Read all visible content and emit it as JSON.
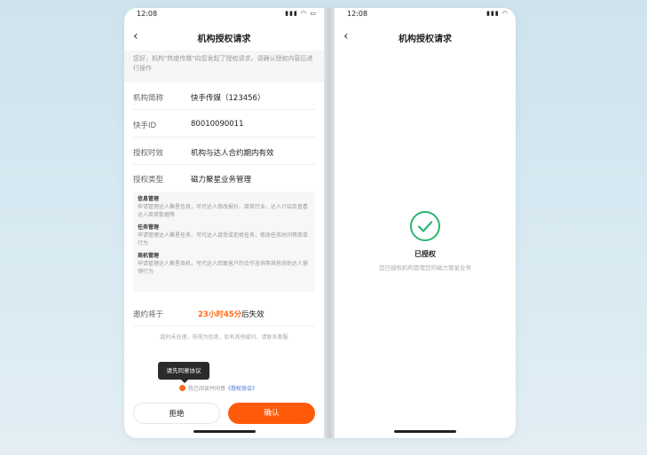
{
  "left": {
    "status_time": "12:08",
    "title": "机构授权请求",
    "notice": "您好，机构\"热度传媒\"向您发起了授权请求，请确认授权内容后进行操作",
    "rows": [
      {
        "key": "机构简称",
        "value": "快手传媒（123456）"
      },
      {
        "key": "快手ID",
        "value": "80010090011"
      },
      {
        "key": "授权时效",
        "value": "机构与达人合约期内有效"
      },
      {
        "key": "授权类型",
        "value": "磁力聚星业务管理"
      }
    ],
    "details": [
      {
        "title": "信息管理",
        "desc": "申请管理达人聚星信息，可代达人修改报价、接单行业、达人介绍及查看达人商单数据等"
      },
      {
        "title": "任务管理",
        "desc": "申请管理达人聚星任务，可代达人接受或拒绝任务，修改任务时间等商单行为"
      },
      {
        "title": "商机管理",
        "desc": "申请管理达人聚星商机，可代达人回复客户的合作咨询等其他协助达人营销行为"
      }
    ],
    "expire": {
      "key": "邀约将于",
      "highlight": "23小时45分",
      "tail": "后失效"
    },
    "hint": "超时未处理，将视为拒绝，如有其他疑问，请联系客服",
    "tooltip": "请先同意协议",
    "agree_prefix": "我已阅读并同意",
    "agree_link": "《授权协议》",
    "reject_label": "拒绝",
    "confirm_label": "确认"
  },
  "right": {
    "status_time": "12:08",
    "title": "机构授权请求",
    "success_title": "已授权",
    "success_sub": "您已授权机构管理您的磁力聚星业务"
  },
  "colors": {
    "accent": "#ff5a0a",
    "success": "#2bb673",
    "link": "#3a6fd8"
  }
}
